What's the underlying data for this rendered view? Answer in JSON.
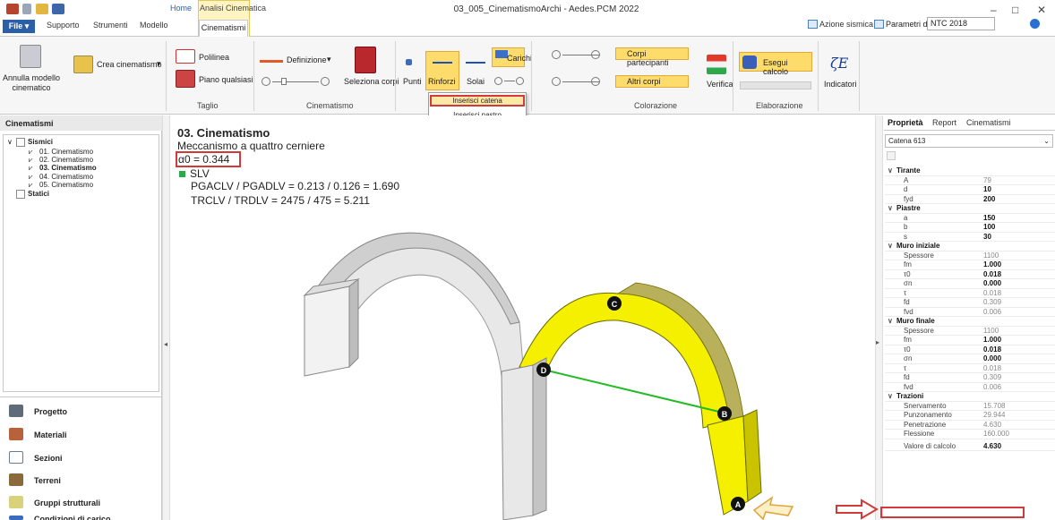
{
  "window": {
    "title": "03_005_CinematismoArchi - Aedes.PCM 2022",
    "controls": [
      "–",
      "□",
      "✕"
    ]
  },
  "tabs": {
    "file": "File ▾",
    "items": [
      "Supporto",
      "Strumenti",
      "Modello"
    ],
    "home": "Home",
    "context_group": "Analisi Cinematica",
    "active": "Cinematismi"
  },
  "topright": {
    "azione_sismica": "Azione sismica",
    "parametri": "Parametri di calcolo",
    "norm": "NTC 2018"
  },
  "ribbon": {
    "annulla": "Annulla modello cinematico",
    "crea": "Crea cinematismo",
    "polilinea": "Polilinea",
    "piano": "Piano qualsiasi",
    "taglio": "Taglio",
    "definizione": "Definizione",
    "seleziona": "Seleziona corpi",
    "cinematismo_grp": "Cinematismo",
    "punti": "Punti",
    "rinforzi": "Rinforzi",
    "solai": "Solai",
    "carichi": "Carichi",
    "corpi_partecipanti": "Corpi partecipanti",
    "altri_corpi": "Altri corpi",
    "colorazione": "Colorazione",
    "verifica": "Verifica",
    "esegui": "Esegui calcolo",
    "elaborazione": "Elaborazione",
    "indicatori": "Indicatori",
    "zeta": "ζE"
  },
  "menu": {
    "items": [
      "Inserisci catena",
      "Inserisci nastro"
    ]
  },
  "left": {
    "header": "Cinematismi",
    "tree": {
      "sismici": "Sismici",
      "items": [
        "01. Cinematismo",
        "02. Cinematismo",
        "03. Cinematismo",
        "04. Cinematismo",
        "05. Cinematismo"
      ],
      "statici": "Statici"
    },
    "nav": [
      "Progetto",
      "Materiali",
      "Sezioni",
      "Terreni",
      "Gruppi strutturali",
      "Condizioni di carico"
    ]
  },
  "results": {
    "title": "03. Cinematismo",
    "subtitle": "Meccanismo a quattro cerniere",
    "alpha": "α0 = 0.344",
    "slv": "SLV",
    "pga": "PGACLV / PGADLV = 0.213 / 0.126 = 1.690",
    "tr": "TRCLV / TRDLV = 2475 / 475 = 5.211"
  },
  "viewport": {
    "hinges": [
      "A",
      "B",
      "C",
      "D"
    ]
  },
  "right": {
    "tabs": [
      "Proprietà",
      "Report",
      "Cinematismi"
    ],
    "selector": "Catena 613",
    "rows": [
      {
        "cat": true,
        "k": "Tirante"
      },
      {
        "k": "A",
        "v": "79"
      },
      {
        "k": "d",
        "v": "10",
        "b": true
      },
      {
        "k": "fyd",
        "v": "200",
        "b": true
      },
      {
        "cat": true,
        "k": "Piastre"
      },
      {
        "k": "a",
        "v": "150",
        "b": true
      },
      {
        "k": "b",
        "v": "100",
        "b": true
      },
      {
        "k": "s",
        "v": "30",
        "b": true
      },
      {
        "cat": true,
        "k": "Muro iniziale"
      },
      {
        "k": "Spessore",
        "v": "1100"
      },
      {
        "k": "fm",
        "v": "1.000",
        "b": true
      },
      {
        "k": "τ0",
        "v": "0.018",
        "b": true
      },
      {
        "k": "σn",
        "v": "0.000",
        "b": true
      },
      {
        "k": "τ",
        "v": "0.018"
      },
      {
        "k": "fd",
        "v": "0.309"
      },
      {
        "k": "fvd",
        "v": "0.006"
      },
      {
        "cat": true,
        "k": "Muro finale"
      },
      {
        "k": "Spessore",
        "v": "1100"
      },
      {
        "k": "fm",
        "v": "1.000",
        "b": true
      },
      {
        "k": "τ0",
        "v": "0.018",
        "b": true
      },
      {
        "k": "σn",
        "v": "0.000",
        "b": true
      },
      {
        "k": "τ",
        "v": "0.018"
      },
      {
        "k": "fd",
        "v": "0.309"
      },
      {
        "k": "fvd",
        "v": "0.006"
      },
      {
        "cat": true,
        "k": "Trazioni"
      },
      {
        "k": "Snervamento",
        "v": "15.708"
      },
      {
        "k": "Punzonamento",
        "v": "29.944"
      },
      {
        "k": "Penetrazione",
        "v": "4.630"
      },
      {
        "k": "Flessione",
        "v": "160.000"
      },
      {
        "k": "Valore di calcolo",
        "v": "4.630",
        "b": true
      }
    ]
  },
  "colors": {
    "accent_yellow": "#f5f000",
    "highlight_red": "#d23a3a",
    "file_blue": "#2b5fa8",
    "chain_green": "#22bb22"
  }
}
